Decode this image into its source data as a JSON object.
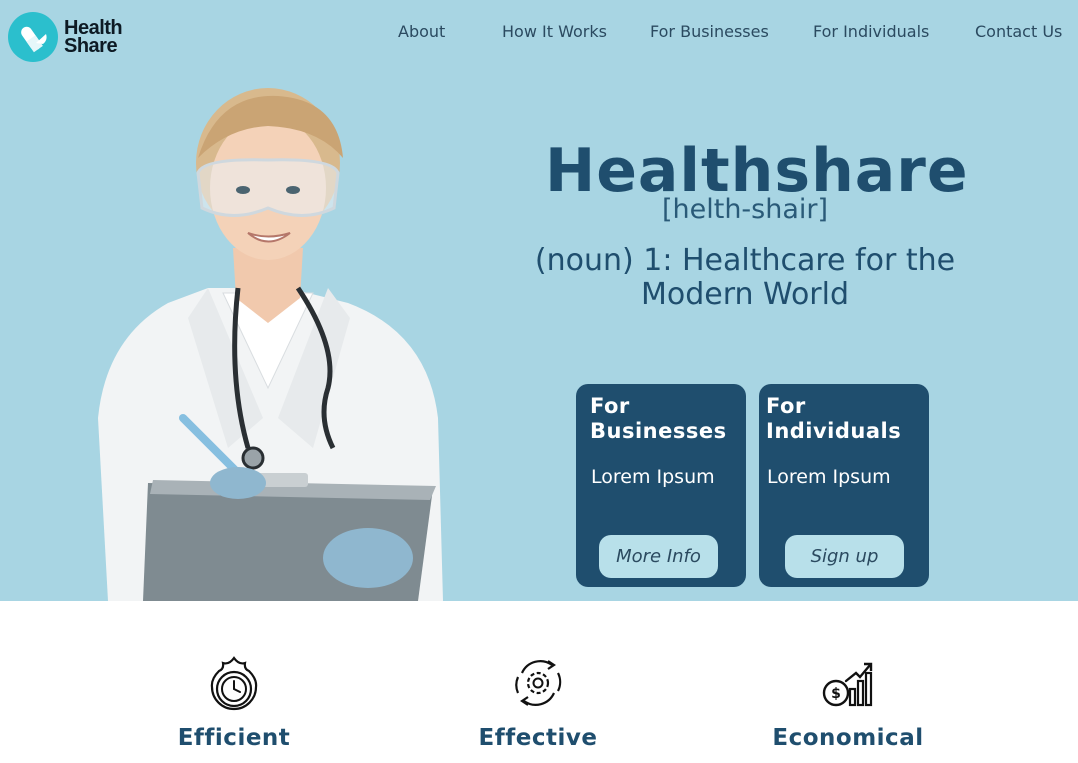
{
  "brand": {
    "name_line1": "Health",
    "name_line2": "Share",
    "accent": "#2bbfcd"
  },
  "nav": {
    "items": [
      {
        "label": "About"
      },
      {
        "label": "How It Works"
      },
      {
        "label": "For Businesses"
      },
      {
        "label": "For Individuals"
      },
      {
        "label": "Contact Us"
      }
    ]
  },
  "hero": {
    "title": "Healthshare",
    "pronunciation": "[helth-shair]",
    "definition": "(noun) 1: Healthcare for the Modern World",
    "background": "#a8d5e3"
  },
  "cards": [
    {
      "title": "For Businesses",
      "subtitle": "Lorem Ipsum",
      "button": "More Info"
    },
    {
      "title": "For Individuals",
      "subtitle": "Lorem Ipsum",
      "button": "Sign up"
    }
  ],
  "features": [
    {
      "label": "Efficient",
      "icon": "stopwatch-icon"
    },
    {
      "label": "Effective",
      "icon": "gear-cycle-icon"
    },
    {
      "label": "Economical",
      "icon": "money-growth-icon"
    }
  ],
  "colors": {
    "primary": "#1f4e6e",
    "button_bg": "#b8e0ea"
  }
}
